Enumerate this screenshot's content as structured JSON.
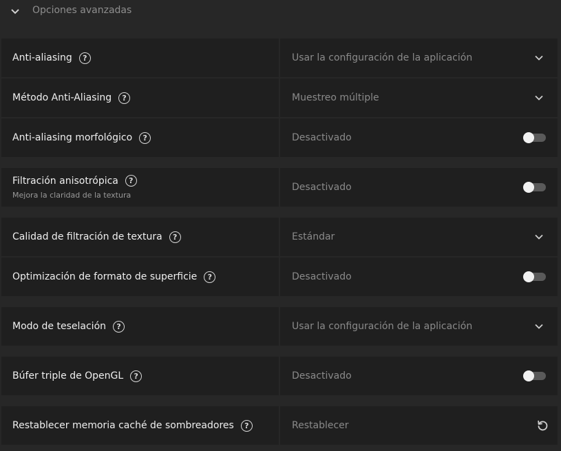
{
  "section": {
    "title": "Opciones avanzadas"
  },
  "rows": [
    {
      "label": "Anti-aliasing",
      "value": "Usar la configuración de la aplicación",
      "control": "dropdown"
    },
    {
      "label": "Método Anti-Aliasing",
      "value": "Muestreo múltiple",
      "control": "dropdown"
    },
    {
      "label": "Anti-aliasing morfológico",
      "value": "Desactivado",
      "control": "toggle",
      "on": false
    },
    {
      "label": "Filtración anisotrópica",
      "sublabel": "Mejora la claridad de la textura",
      "value": "Desactivado",
      "control": "toggle",
      "on": false
    },
    {
      "label": "Calidad de filtración de textura",
      "value": "Estándar",
      "control": "dropdown"
    },
    {
      "label": "Optimización de formato de superficie",
      "value": "Desactivado",
      "control": "toggle",
      "on": false
    },
    {
      "label": "Modo de teselación",
      "value": "Usar la configuración de la aplicación",
      "control": "dropdown"
    },
    {
      "label": "Búfer triple de OpenGL",
      "value": "Desactivado",
      "control": "toggle",
      "on": false
    },
    {
      "label": "Restablecer memoria caché de sombreadores",
      "value": "Restablecer",
      "control": "reset"
    }
  ],
  "help_glyph": "?",
  "icons": {
    "header": "chevron-down-icon",
    "dropdown": "chevron-down-icon",
    "help": "help-circle-icon",
    "reset": "reset-icon"
  },
  "colors": {
    "background": "#272727",
    "panel": "#1f1f1f",
    "label": "#efefef",
    "value": "#8a8a8a",
    "toggle_track": "#5a5a5a",
    "toggle_knob": "#f2f2f2"
  }
}
